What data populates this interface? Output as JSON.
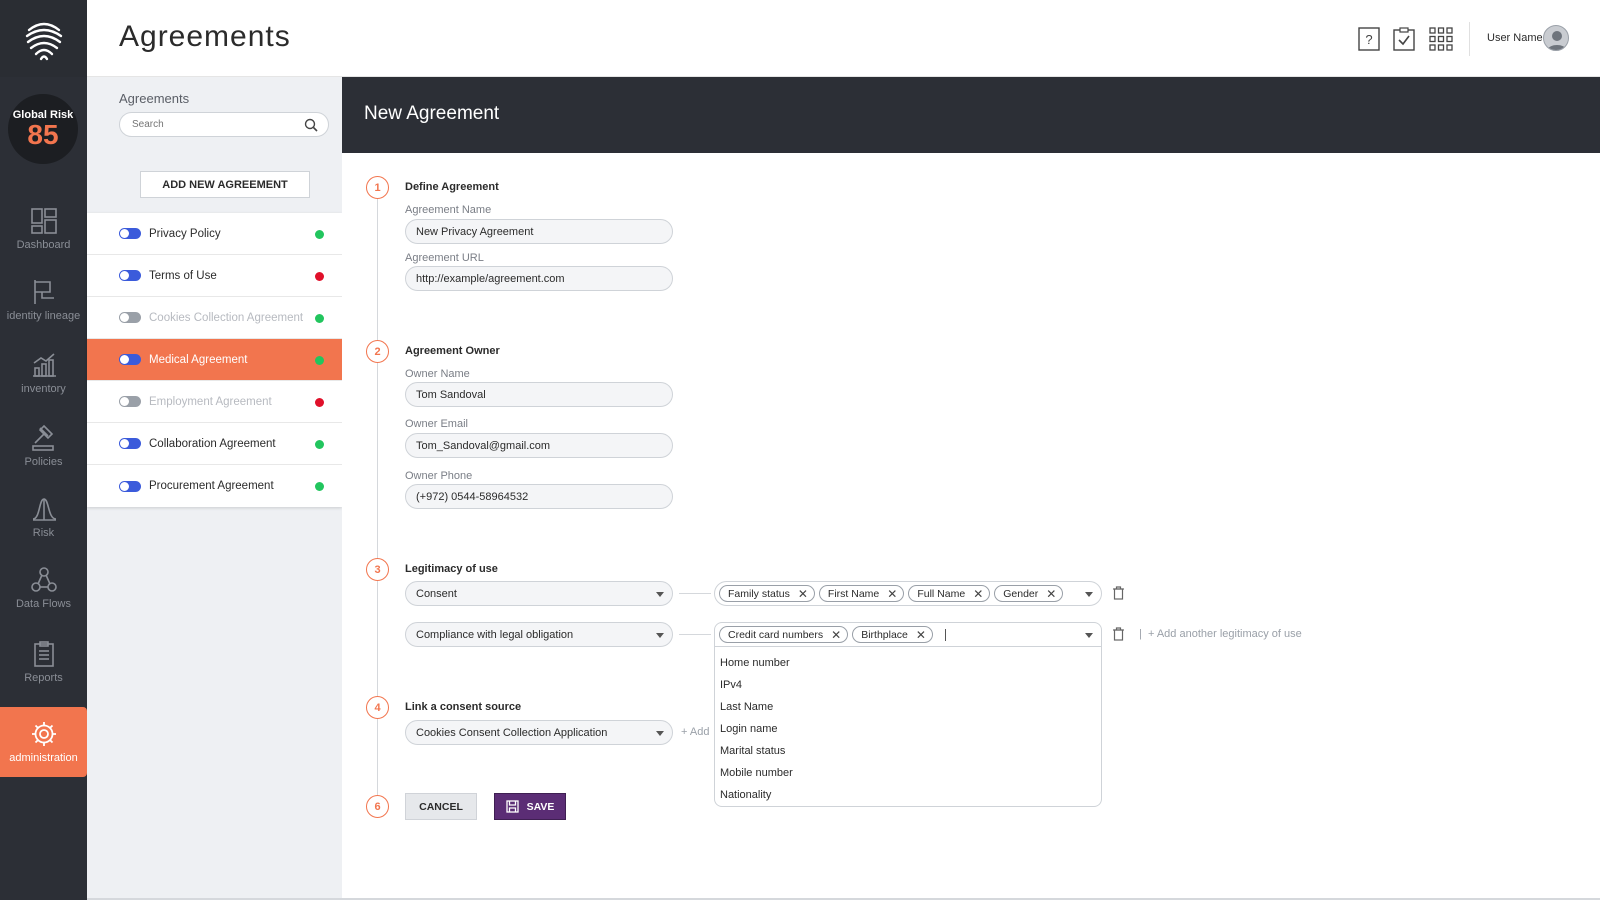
{
  "header": {
    "page_title": "Agreements",
    "user_name": "User Name",
    "icons": [
      "help-icon",
      "checklist-icon",
      "apps-grid-icon",
      "user-avatar-icon"
    ]
  },
  "rail": {
    "risk_label": "Global Risk",
    "risk_value": "85",
    "items": [
      {
        "label": "Dashboard",
        "icon": "dashboard-icon"
      },
      {
        "label": "identity lineage",
        "icon": "flag-icon"
      },
      {
        "label": "inventory",
        "icon": "chart-icon"
      },
      {
        "label": "Policies",
        "icon": "gavel-icon"
      },
      {
        "label": "Risk",
        "icon": "bell-curve-icon"
      },
      {
        "label": "Data Flows",
        "icon": "network-icon"
      },
      {
        "label": "Reports",
        "icon": "clipboard-icon"
      },
      {
        "label": "administration",
        "icon": "gear-icon"
      }
    ],
    "active_item": "administration"
  },
  "list": {
    "title": "Agreements",
    "search_placeholder": "Search",
    "add_button": "ADD NEW AGREEMENT",
    "items": [
      {
        "label": "Privacy Policy",
        "enabled": true,
        "status": "green"
      },
      {
        "label": "Terms of Use",
        "enabled": true,
        "status": "red"
      },
      {
        "label": "Cookies Collection Agreement",
        "enabled": false,
        "status": "green"
      },
      {
        "label": "Medical Agreement",
        "enabled": true,
        "status": "green"
      },
      {
        "label": "Employment Agreement",
        "enabled": false,
        "status": "red"
      },
      {
        "label": "Collaboration Agreement",
        "enabled": true,
        "status": "green"
      },
      {
        "label": "Procurement Agreement",
        "enabled": true,
        "status": "green"
      }
    ],
    "selected": "Medical Agreement"
  },
  "form": {
    "title": "New Agreement",
    "steps": [
      "1",
      "2",
      "3",
      "4",
      "6"
    ],
    "define": {
      "title": "Define Agreement",
      "name_label": "Agreement Name",
      "name_value": "New Privacy Agreement",
      "url_label": "Agreement URL",
      "url_value": "http://example/agreement.com"
    },
    "owner": {
      "title": "Agreement Owner",
      "name_label": "Owner Name",
      "name_value": "Tom Sandoval",
      "email_label": "Owner Email",
      "email_value": "Tom_Sandoval@gmail.com",
      "phone_label": "Owner Phone",
      "phone_value": "(+972) 0544-58964532"
    },
    "legitimacy": {
      "title": "Legitimacy of use",
      "row1_select": "Consent",
      "row1_tags": [
        "Family status",
        "First Name",
        "Full Name",
        "Gender"
      ],
      "row2_select": "Compliance with legal obligation",
      "row2_tags": [
        "Credit card numbers",
        "Birthplace"
      ],
      "add_another": "Add another legitimacy of use",
      "dropdown_options": [
        "Home number",
        "IPv4",
        "Last Name",
        "Login name",
        "Marital status",
        "Mobile number",
        "Nationality"
      ]
    },
    "consent": {
      "title": "Link a consent source",
      "select_value": "Cookies Consent Collection Application",
      "add_link": "Add"
    },
    "buttons": {
      "cancel": "CANCEL",
      "save": "SAVE"
    }
  },
  "colors": {
    "accent": "#f2754e",
    "dark": "#2c2f36",
    "save": "#5b2d75",
    "toggle_on": "#3b5bdb",
    "status_green": "#22c55e",
    "status_red": "#e0102a"
  }
}
